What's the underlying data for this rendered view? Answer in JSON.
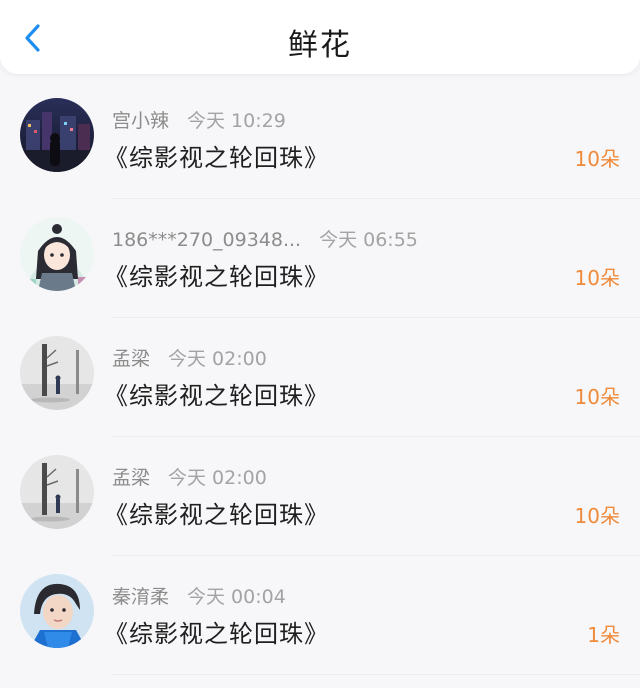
{
  "header": {
    "title": "鲜花",
    "back_icon": "chevron-left-icon",
    "accent": "#1e8ef0"
  },
  "count_color": "#ef8a3a",
  "entries": [
    {
      "user": "宫小辣",
      "time": "今天 10:29",
      "book": "《综影视之轮回珠》",
      "count": "10朵"
    },
    {
      "user": "186***270_09348...",
      "time": "今天 06:55",
      "book": "《综影视之轮回珠》",
      "count": "10朵"
    },
    {
      "user": "孟梁",
      "time": "今天 02:00",
      "book": "《综影视之轮回珠》",
      "count": "10朵"
    },
    {
      "user": "孟梁",
      "time": "今天 02:00",
      "book": "《综影视之轮回珠》",
      "count": "10朵"
    },
    {
      "user": "秦淯柔",
      "time": "今天 00:04",
      "book": "《综影视之轮回珠》",
      "count": "1朵"
    }
  ]
}
